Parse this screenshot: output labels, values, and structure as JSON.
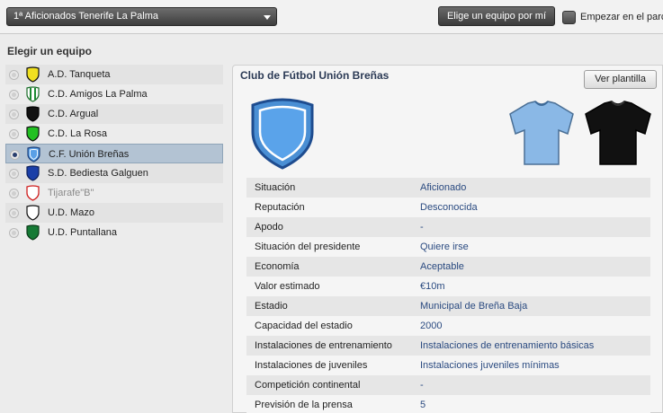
{
  "topbar": {
    "league": "1ª Aficionados Tenerife La Palma",
    "pick_button": "Elige un equipo por mí",
    "start_label": "Empezar en el parc"
  },
  "left": {
    "title": "Elegir un equipo",
    "teams": [
      {
        "name": "A.D. Tanqueta",
        "crest": "yellow-shield-icon"
      },
      {
        "name": "C.D. Amigos La Palma",
        "crest": "green-white-striped-shield-icon"
      },
      {
        "name": "C.D. Argual",
        "crest": "black-shield-icon"
      },
      {
        "name": "C.D. La Rosa",
        "crest": "green-shield-icon"
      },
      {
        "name": "C.F. Unión Breñas",
        "crest": "light-blue-shield-icon",
        "selected": true
      },
      {
        "name": "S.D. Bediesta Galguen",
        "crest": "blue-shield-icon"
      },
      {
        "name": "Tijarafe\"B\"",
        "crest": "red-outline-shield-icon"
      },
      {
        "name": "U.D. Mazo",
        "crest": "white-shield-icon"
      },
      {
        "name": "U.D. Puntallana",
        "crest": "dark-green-shield-icon"
      }
    ]
  },
  "club": {
    "name": "Club de Fútbol Unión Breñas",
    "squad_button": "Ver plantilla",
    "colors": {
      "home": "#8ab8e6",
      "away": "#111111",
      "crest": "#4a8fd4"
    },
    "info": [
      {
        "label": "Situación",
        "value": "Aficionado"
      },
      {
        "label": "Reputación",
        "value": "Desconocida"
      },
      {
        "label": "Apodo",
        "value": "-"
      },
      {
        "label": "Situación del presidente",
        "value": "Quiere irse"
      },
      {
        "label": "Economía",
        "value": "Aceptable"
      },
      {
        "label": "Valor estimado",
        "value": "€10m"
      },
      {
        "label": "Estadio",
        "value": "Municipal de Breña Baja"
      },
      {
        "label": "Capacidad del estadio",
        "value": "2000"
      },
      {
        "label": "Instalaciones de entrenamiento",
        "value": "Instalaciones de entrenamiento básicas"
      },
      {
        "label": "Instalaciones de juveniles",
        "value": "Instalaciones juveniles mínimas"
      },
      {
        "label": "Competición continental",
        "value": "-"
      },
      {
        "label": "Previsión de la prensa",
        "value": "5"
      }
    ]
  }
}
